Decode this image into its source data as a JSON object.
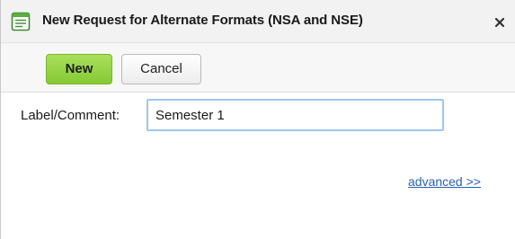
{
  "dialog": {
    "title": "New Request for Alternate Formats (NSA and NSE)",
    "title_icon": "form-document-icon",
    "close_icon": "close-icon"
  },
  "toolbar": {
    "new_label": "New",
    "cancel_label": "Cancel"
  },
  "form": {
    "label_comment": {
      "label": "Label/Comment:",
      "value": "Semester 1"
    },
    "advanced_link": "advanced >>"
  },
  "colors": {
    "new_button_green": "#8fd041",
    "input_focus_border": "#9ec6ea",
    "link_blue": "#2a5fb0"
  }
}
